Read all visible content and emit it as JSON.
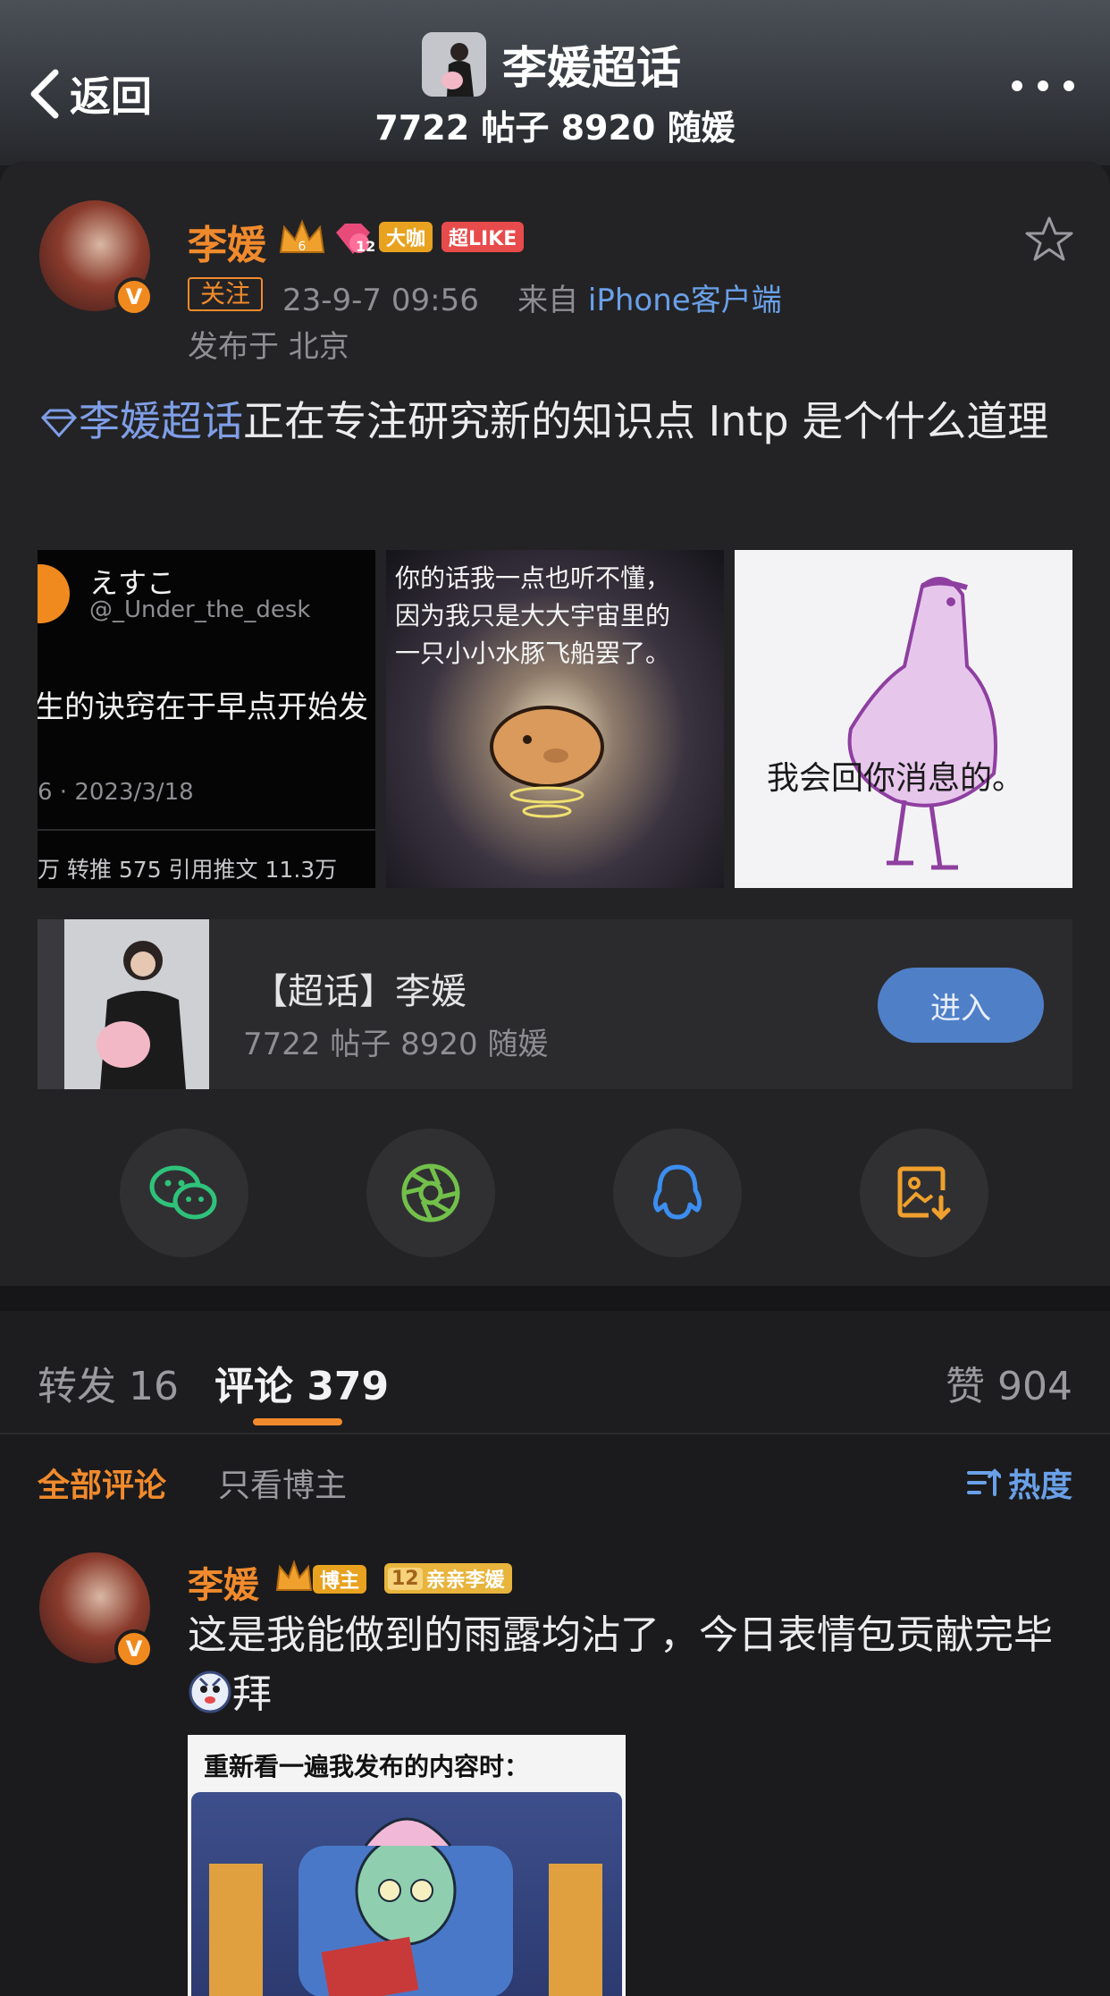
{
  "header": {
    "back_label": "返回",
    "title": "李媛超话",
    "subtitle": "7722 帖子 8920 随媛"
  },
  "post": {
    "author": "李媛",
    "badges": [
      "大咖",
      "超LIKE"
    ],
    "level_badge": "12",
    "follow_label": "关注",
    "time": "23-9-7 09:56",
    "from_prefix": "来自",
    "client": "iPhone客户端",
    "location": "发布于 北京",
    "topic_link": "李媛超话",
    "text": "正在专注研究新的知识点 Intp 是个什么道理",
    "images": [
      {
        "lines": [
          "えすこ",
          "@_Under_the_desk",
          "生的诀窍在于早点开始发",
          "6 · 2023/3/18",
          "万 转推  575 引用推文  11.3万"
        ]
      },
      {
        "lines": [
          "你的话我一点也听不懂，",
          "因为我只是大大宇宙里的",
          "一只小小水豚飞船罢了。"
        ]
      },
      {
        "lines": [
          "我会回你消息的。"
        ]
      }
    ]
  },
  "topic_card": {
    "title": "【超话】李媛",
    "subtitle": "7722 帖子 8920 随媛",
    "enter_label": "进入"
  },
  "share": [
    {
      "icon": "wechat-icon",
      "color": "#2fc27a"
    },
    {
      "icon": "moments-icon",
      "color": "#72c04a"
    },
    {
      "icon": "qq-icon",
      "color": "#3c8ef0"
    },
    {
      "icon": "save-image-icon",
      "color": "#f0a02c"
    }
  ],
  "tabs": {
    "repost": "转发 16",
    "comment": "评论 379",
    "like": "赞 904"
  },
  "filters": {
    "all": "全部评论",
    "owner_only": "只看博主",
    "sort": "热度"
  },
  "comment": {
    "author": "李媛",
    "owner_badge": "博主",
    "fan_badge": "亲亲李媛",
    "fan_level": "12",
    "text": "这是我能做到的雨露均沾了，今日表情包贡献完毕",
    "text_suffix": "拜",
    "image_caption": "重新看一遍我发布的内容时："
  },
  "colors": {
    "accent_orange": "#f08a2c",
    "link_blue": "#6aa0e8",
    "background": "#1b1b1d"
  }
}
